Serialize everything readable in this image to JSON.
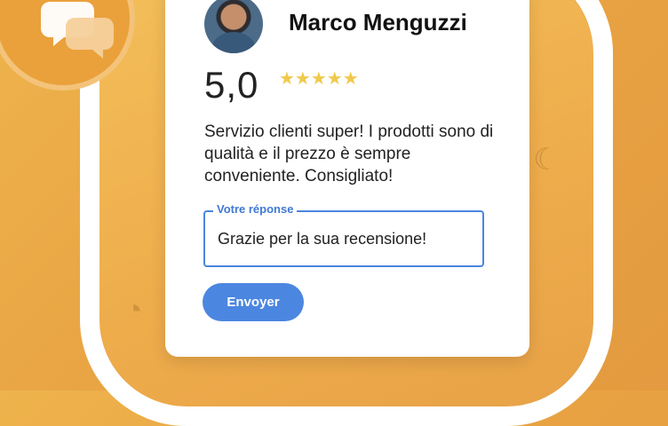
{
  "review_card": {
    "reviewer_name": "Marco Menguzzi",
    "rating_value": "5,0",
    "stars": "★★★★★",
    "review_text": "Servizio clienti super! I prodotti sono di qualità e il prezzo è sempre conveniente. Consigliato!"
  },
  "response": {
    "label": "Votre réponse",
    "value": "Grazie per la sua recensione!"
  },
  "actions": {
    "send_label": "Envoyer"
  },
  "colors": {
    "background": "#e9a443",
    "accent_blue": "#4b86e0",
    "star_color": "#f0c94c"
  },
  "icons": {
    "badge": "chat-bubbles-icon",
    "rating": "star-icon"
  }
}
